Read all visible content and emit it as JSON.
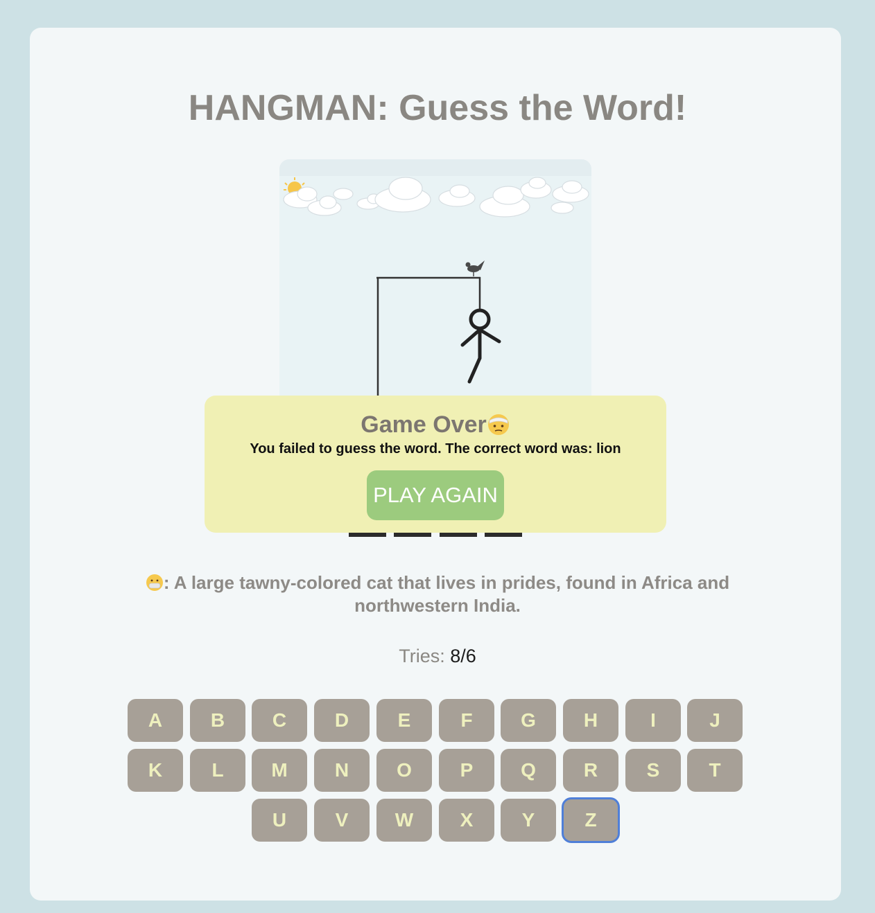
{
  "title": "HANGMAN: Guess the Word!",
  "hangman": {
    "wrong_guesses": 8,
    "parts_drawn": [
      "gallows",
      "rope",
      "head",
      "body",
      "left-arm",
      "right-arm",
      "left-leg"
    ],
    "decorations": [
      "sun-behind-cloud-icon",
      "cloud-icon",
      "bird-icon"
    ]
  },
  "word": {
    "length": 4,
    "revealed": [
      "",
      "",
      "",
      ""
    ]
  },
  "modal": {
    "title": "Game Over",
    "face_icon": "face-with-head-bandage-icon",
    "message": "You failed to guess the word. The correct word was: lion",
    "button_label": "PLAY AGAIN",
    "background": "#f0f0b4",
    "button_color": "#9ccb7e"
  },
  "hint": {
    "icon": "face-with-mask-icon",
    "text": ": A large tawny-colored cat that lives in prides, found in Africa and northwestern India."
  },
  "tries": {
    "label": "Tries: ",
    "value": "8/6"
  },
  "keyboard": {
    "rows": [
      [
        "A",
        "B",
        "C",
        "D",
        "E",
        "F",
        "G",
        "H",
        "I",
        "J"
      ],
      [
        "K",
        "L",
        "M",
        "N",
        "O",
        "P",
        "Q",
        "R",
        "S",
        "T"
      ],
      [
        "U",
        "V",
        "W",
        "X",
        "Y",
        "Z"
      ]
    ],
    "focused_key": "Z",
    "key_color": "#a7a097",
    "key_text_color": "#eef0be"
  }
}
